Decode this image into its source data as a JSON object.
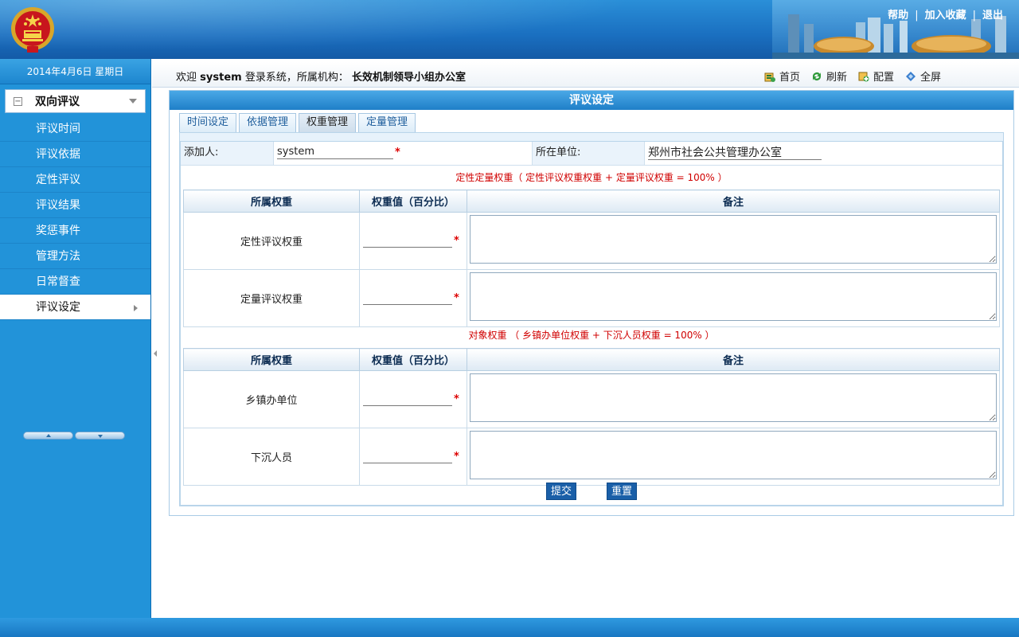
{
  "header": {
    "links": [
      "帮助",
      "加入收藏",
      "退出"
    ],
    "separator": "|"
  },
  "sidebar": {
    "date": "2014年4月6日  星期日",
    "group_title": "双向评议",
    "items": [
      {
        "label": "评议时间"
      },
      {
        "label": "评议依据"
      },
      {
        "label": "定性评议"
      },
      {
        "label": "评议结果"
      },
      {
        "label": "奖惩事件"
      },
      {
        "label": "管理方法"
      },
      {
        "label": "日常督查"
      },
      {
        "label": "评议设定",
        "active": true
      }
    ]
  },
  "infobar": {
    "welcome_prefix": "欢迎",
    "username": "system",
    "welcome_mid": "登录系统，所属机构：",
    "org": "长效机制领导小组办公室",
    "toolbar": {
      "home": "首页",
      "refresh": "刷新",
      "config": "配置",
      "fullscreen": "全屏"
    }
  },
  "panel": {
    "title": "评议设定",
    "tabs": [
      "时间设定",
      "依据管理",
      "权重管理",
      "定量管理"
    ],
    "active_tab": "权重管理",
    "adder_label": "添加人:",
    "adder_value": "system",
    "unit_label": "所在单位:",
    "unit_value": "郑州市社会公共管理办公室",
    "required_mark": "*",
    "formula1": "定性定量权重（ 定性评议权重权重 + 定量评议权重 = 100% ）",
    "formula2": "对象权重 （ 乡镇办单位权重 + 下沉人员权重 = 100% ）",
    "table_headers": [
      "所属权重",
      "权重值（百分比）",
      "备注"
    ],
    "table1_rows": [
      {
        "name": "定性评议权重",
        "value": "",
        "note": ""
      },
      {
        "name": "定量评议权重",
        "value": "",
        "note": ""
      }
    ],
    "table2_rows": [
      {
        "name": "乡镇办单位",
        "value": "",
        "note": ""
      },
      {
        "name": "下沉人员",
        "value": "",
        "note": ""
      }
    ],
    "submit_label": "提交",
    "reset_label": "重置"
  },
  "colors": {
    "brand_blue": "#1f7fc8",
    "required_red": "#d00000",
    "button_blue": "#1a5fa8"
  }
}
